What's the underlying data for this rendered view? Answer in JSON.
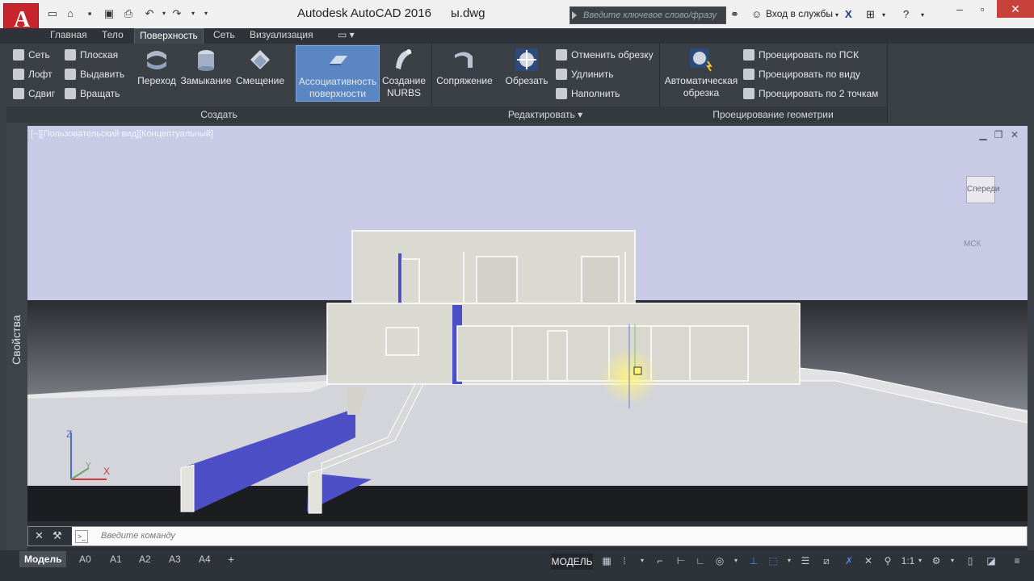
{
  "app": {
    "title": "Autodesk AutoCAD 2016",
    "file": "ы.dwg"
  },
  "search": {
    "placeholder": "Введите ключевое слово/фразу"
  },
  "account": {
    "signin": "Вход в службы"
  },
  "tabs": [
    "Главная",
    "Тело",
    "Поверхность",
    "Сеть",
    "Визуализация"
  ],
  "active_tab": "Поверхность",
  "ribbon": {
    "create": {
      "title": "Создать",
      "small": [
        "Сеть",
        "Плоская",
        "Лофт",
        "Выдавить",
        "Сдвиг",
        "Вращать"
      ],
      "large": [
        {
          "label": "Переход",
          "icon": "blend-icon"
        },
        {
          "label": "Замыкание",
          "icon": "patch-icon"
        },
        {
          "label": "Смещение",
          "icon": "offset-icon"
        },
        {
          "label": "Ассоциативность поверхности",
          "icon": "associativity-icon",
          "active": true
        },
        {
          "label": "Создание NURBS",
          "icon": "nurbs-icon"
        }
      ]
    },
    "edit": {
      "title": "Редактировать",
      "large": [
        {
          "label": "Сопряжение",
          "icon": "fillet-icon"
        },
        {
          "label": "Обрезать",
          "icon": "trim-icon"
        }
      ],
      "small": [
        "Отменить обрезку",
        "Удлинить",
        "Наполнить"
      ]
    },
    "project": {
      "title": "Проецирование геометрии",
      "large": {
        "label": "Автоматическая обрезка",
        "icon": "auto-trim-icon"
      },
      "small": [
        "Проецировать по ПСК",
        "Проецировать по виду",
        "Проецировать по 2 точкам"
      ]
    }
  },
  "palette": {
    "properties": "Свойства"
  },
  "viewport": {
    "label": "[−][Пользовательский вид][Концептуальный]",
    "viewcube_face": "Спереди",
    "ucs_label": "МСК"
  },
  "command": {
    "placeholder": "Введите команду"
  },
  "layouts": [
    "Модель",
    "А0",
    "А1",
    "А2",
    "А3",
    "А4"
  ],
  "status": {
    "space": "МОДЕЛЬ",
    "scale": "1:1"
  },
  "colors": {
    "accent_blue": "#4d5fd0",
    "ribbon_active": "#5b86c4",
    "sky": "#c9cbe6",
    "close_red": "#c7423b"
  }
}
